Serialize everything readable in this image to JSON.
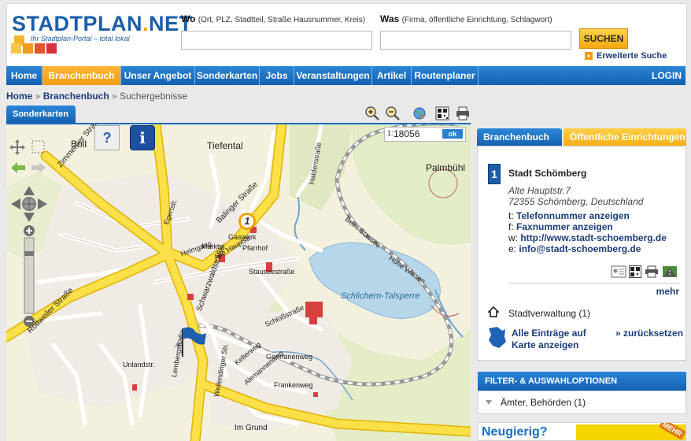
{
  "logo": {
    "name": "STADTPLAN",
    "ext": "NET",
    "tagline": "Ihr Stadtplan-Portal – total lokal"
  },
  "search": {
    "wo_label": "Wo",
    "wo_hint": "(Ort, PLZ, Stadtteil, Straße Hausnummer, Kreis)",
    "was_label": "Was",
    "was_hint": "(Firma, öffentliche Einrichtung, Schlagwort)",
    "wo_value": "",
    "was_value": "",
    "button": "SUCHEN",
    "advanced": "Erweiterte Suche"
  },
  "nav": {
    "items": [
      {
        "label": "Home"
      },
      {
        "label": "Branchenbuch"
      },
      {
        "label": "Unser Angebot »"
      },
      {
        "label": "Sonderkarten"
      },
      {
        "label": "Jobs"
      },
      {
        "label": "Veranstaltungen"
      },
      {
        "label": "Artikel"
      },
      {
        "label": "Routenplaner"
      }
    ],
    "login": "LOGIN"
  },
  "breadcrumb": {
    "home": "Home",
    "section": "Branchenbuch",
    "current": "Suchergebnisse",
    "separator": "»"
  },
  "map": {
    "tab": "Sonderkarten",
    "scale_prefix": "1:",
    "scale_value": "18056",
    "ok": "ok",
    "marker_number": "1",
    "labels": {
      "boll": "Boll",
      "tiefental": "Tiefental",
      "palmbuehl": "Palmbühl",
      "zimmerner": "Zimmerner Straße",
      "balinger": "Balinger Straße",
      "rottweiler": "Rottweiler Straße",
      "schwarzwald": "Schwarzwaldstraße",
      "stauseestr": "Stauseestraße",
      "beim_stausee": "Beim Stausee",
      "hohe_wiesen": "Hohe Wiesen",
      "talsperre": "Schlichern-Talsperre",
      "schlossstr": "Schloßstraße",
      "lembergstr": "Lembergstraße",
      "germanenweg": "Germanenweg",
      "frankenweg": "Frankenweg",
      "alemannenweg": "Alemannenweg",
      "kelterweg": "Kelterweg",
      "unlandstr": "Unlandstr.",
      "weilendinger": "Weilendinger Str.",
      "haldenstr": "Haldenstraße",
      "marktpl": "Marktpl.",
      "alte_hauptstr": "Alte Hauptstr.",
      "gaswerk": "Gaswerk",
      "egertstr": "Egertstr.",
      "im_grund": "Im Grund",
      "heimgang": "Heimgang",
      "pfarrhof": "Pfarrhof"
    }
  },
  "right_tabs": {
    "branchenbuch": "Branchenbuch",
    "oeffentlich": "Öffentliche Einrichtungen"
  },
  "result": {
    "number": "1",
    "name": "Stadt Schömberg",
    "street": "Alte Hauptstr.7",
    "city": "72355 Schömberg, Deutschland",
    "t_prefix": "t:",
    "t_link": "Telefonnummer anzeigen",
    "f_prefix": "f:",
    "f_link": "Faxnummer anzeigen",
    "w_prefix": "w:",
    "w_link": "http://www.stadt-schoemberg.de",
    "e_prefix": "e:",
    "e_link": "info@stadt-schoemberg.de",
    "more": "mehr",
    "category": "Stadtverwaltung (1)",
    "show_all": "Alle Einträge auf Karte anzeigen",
    "reset": "» zurücksetzen"
  },
  "filter": {
    "title": "FILTER- & AUSWAHLOPTIONEN",
    "item": "Ämter, Behörden",
    "count": "(1)"
  },
  "ad": {
    "text": "Neugierig?",
    "badge": "MEHR"
  },
  "colors": {
    "brand_blue": "#1b5ea8",
    "nav_blue": "#1a6cbf",
    "accent_orange": "#f39c12",
    "link": "#1b3c7a"
  }
}
